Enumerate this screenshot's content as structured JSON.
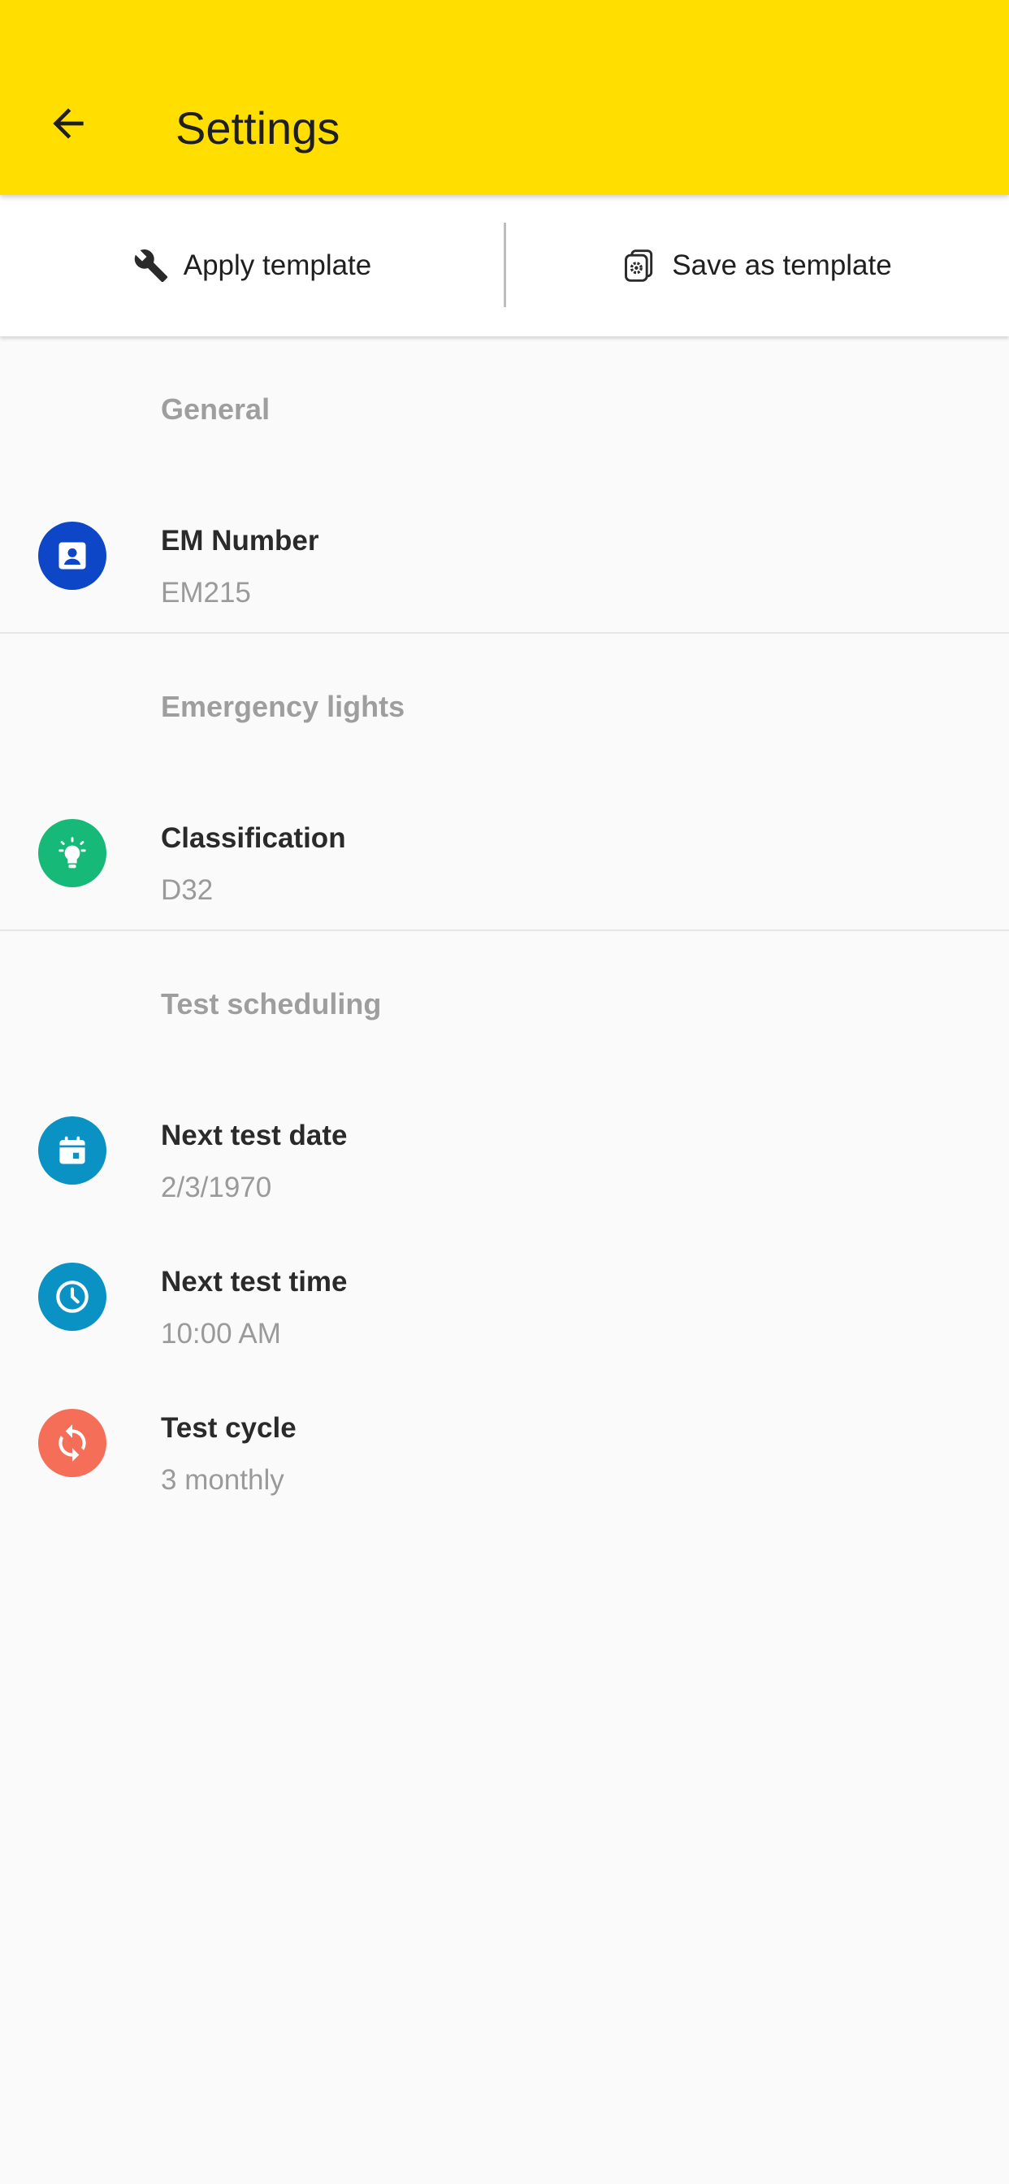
{
  "app_bar": {
    "title": "Settings",
    "background_color": "#FFDE00",
    "back_icon": "arrow-left-icon"
  },
  "template_bar": {
    "apply_label": "Apply template",
    "apply_icon": "wrench-icon",
    "save_label": "Save as template",
    "save_icon": "settings-copy-icon"
  },
  "sections": [
    {
      "header": "General",
      "items": [
        {
          "title": "EM Number",
          "value": "EM215",
          "icon": "contact-card-icon",
          "color": "#0D47C8"
        }
      ]
    },
    {
      "header": "Emergency lights",
      "items": [
        {
          "title": "Classification",
          "value": "D32",
          "icon": "lightbulb-icon",
          "color": "#17B978"
        }
      ]
    },
    {
      "header": "Test scheduling",
      "items": [
        {
          "title": "Next test date",
          "value": "2/3/1970",
          "icon": "calendar-icon",
          "color": "#0A92C4"
        },
        {
          "title": "Next test time",
          "value": "10:00 AM",
          "icon": "clock-icon",
          "color": "#0A92C4"
        },
        {
          "title": "Test cycle",
          "value": "3 monthly",
          "icon": "sync-icon",
          "color": "#F56E57"
        }
      ]
    }
  ]
}
